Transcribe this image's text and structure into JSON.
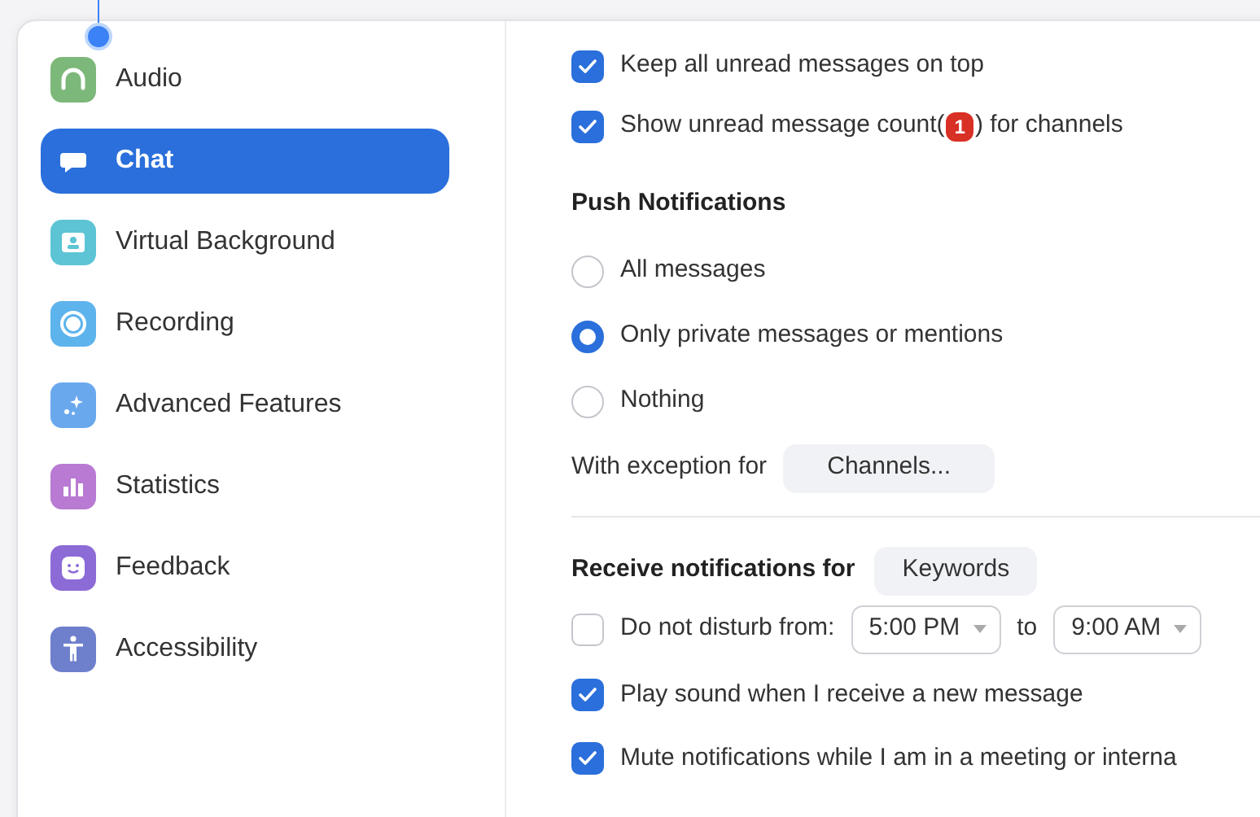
{
  "sidebar": {
    "items": [
      {
        "label": "Audio",
        "selected": false,
        "color": "#7cb87a"
      },
      {
        "label": "Chat",
        "selected": true
      },
      {
        "label": "Virtual Background",
        "selected": false,
        "color": "#5cc4d4"
      },
      {
        "label": "Recording",
        "selected": false,
        "color": "#5db3ec"
      },
      {
        "label": "Advanced Features",
        "selected": false,
        "color": "#6aa8ee"
      },
      {
        "label": "Statistics",
        "selected": false,
        "color": "#b87ad2"
      },
      {
        "label": "Feedback",
        "selected": false,
        "color": "#8d6bd6"
      },
      {
        "label": "Accessibility",
        "selected": false,
        "color": "#6e7fcc"
      }
    ]
  },
  "top_options": [
    {
      "label": "Keep all unread messages on top",
      "checked": true
    },
    {
      "label": "Show unread message count(",
      "badge": "1",
      "label_after": ") for channels",
      "checked": true
    }
  ],
  "push_notifications": {
    "heading": "Push Notifications",
    "options": [
      {
        "label": "All messages",
        "selected": false
      },
      {
        "label": "Only private messages or mentions",
        "selected": true
      },
      {
        "label": "Nothing",
        "selected": false
      }
    ],
    "exception_label": "With exception for",
    "exception_button": "Channels..."
  },
  "receive": {
    "heading": "Receive notifications for",
    "button": "Keywords"
  },
  "dnd": {
    "label": "Do not disturb from:",
    "checked": false,
    "from": "5:00 PM",
    "to_label": "to",
    "to": "9:00 AM"
  },
  "bottom_options": [
    {
      "label": "Play sound when I receive a new message",
      "checked": true
    },
    {
      "label": "Mute notifications while I am in a meeting or interna",
      "checked": true
    }
  ]
}
